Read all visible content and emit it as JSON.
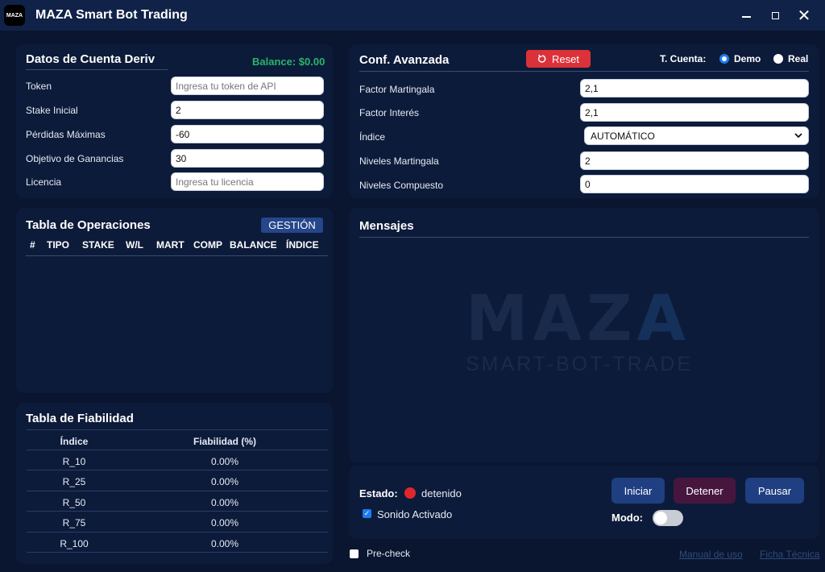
{
  "window": {
    "logo_text": "MAZA",
    "title": "MAZA Smart Bot Trading",
    "controls": {
      "minimize": "minimize-icon",
      "maximize": "maximize-icon",
      "close": "✕"
    }
  },
  "account": {
    "title": "Datos de Cuenta Deriv",
    "balance": "Balance: $0.00",
    "fields": [
      {
        "label": "Token",
        "value": "",
        "placeholder": "Ingresa tu token de API"
      },
      {
        "label": "Stake Inicial",
        "value": "2",
        "placeholder": ""
      },
      {
        "label": "Pérdidas Máximas",
        "value": "-60",
        "placeholder": ""
      },
      {
        "label": "Objetivo de Ganancias",
        "value": "30",
        "placeholder": ""
      },
      {
        "label": "Licencia",
        "value": "",
        "placeholder": "Ingresa tu licencia"
      }
    ]
  },
  "advanced": {
    "title": "Conf. Avanzada",
    "reset_label": "Reset",
    "account_type_label": "T. Cuenta:",
    "account_types": [
      {
        "label": "Demo",
        "selected": true
      },
      {
        "label": "Real",
        "selected": false
      }
    ],
    "fields": [
      {
        "label": "Factor Martingala",
        "value": "2,1"
      },
      {
        "label": "Factor Interés",
        "value": "2,1"
      },
      {
        "label": "Índice",
        "value": "AUTOMÁTICO"
      },
      {
        "label": "Niveles Martingala",
        "value": "2"
      },
      {
        "label": "Niveles Compuesto",
        "value": "0"
      }
    ]
  },
  "operations": {
    "title": "Tabla de Operaciones",
    "gestion_label": "GESTIÓN",
    "columns": [
      "#",
      "TIPO",
      "STAKE",
      "W/L",
      "MART",
      "COMP",
      "BALANCE",
      "ÍNDICE"
    ],
    "rows": []
  },
  "reliability": {
    "title": "Tabla de Fiabilidad",
    "columns": [
      "Índice",
      "Fiabilidad (%)"
    ],
    "rows": [
      {
        "index": "R_10",
        "value": "0.00%"
      },
      {
        "index": "R_25",
        "value": "0.00%"
      },
      {
        "index": "R_50",
        "value": "0.00%"
      },
      {
        "index": "R_75",
        "value": "0.00%"
      },
      {
        "index": "R_100",
        "value": "0.00%"
      }
    ]
  },
  "messages": {
    "title": "Mensajes",
    "watermark_main_a": "MAZ",
    "watermark_main_b": "A",
    "watermark_sub": "SMART-BOT-TRADE"
  },
  "controls": {
    "estado_label": "Estado:",
    "estado_value": "detenido",
    "sound_label": "Sonido Activado",
    "sound_checked": true,
    "start_label": "Iniciar",
    "stop_label": "Detener",
    "pause_label": "Pausar",
    "mode_label": "Modo:",
    "mode_on": false
  },
  "footer": {
    "precheck_label": "Pre-check",
    "precheck_checked": false,
    "manual_link": "Manual de uso",
    "ficha_link": "Ficha Técnica"
  },
  "colors": {
    "background": "#0a1530",
    "panel": "#0d1b3a",
    "reset": "#dc3139",
    "start": "#1f3f82",
    "stop": "#46163e",
    "pause": "#1f3f82",
    "balance": "#27b46b",
    "status_stopped": "#e0262d"
  }
}
